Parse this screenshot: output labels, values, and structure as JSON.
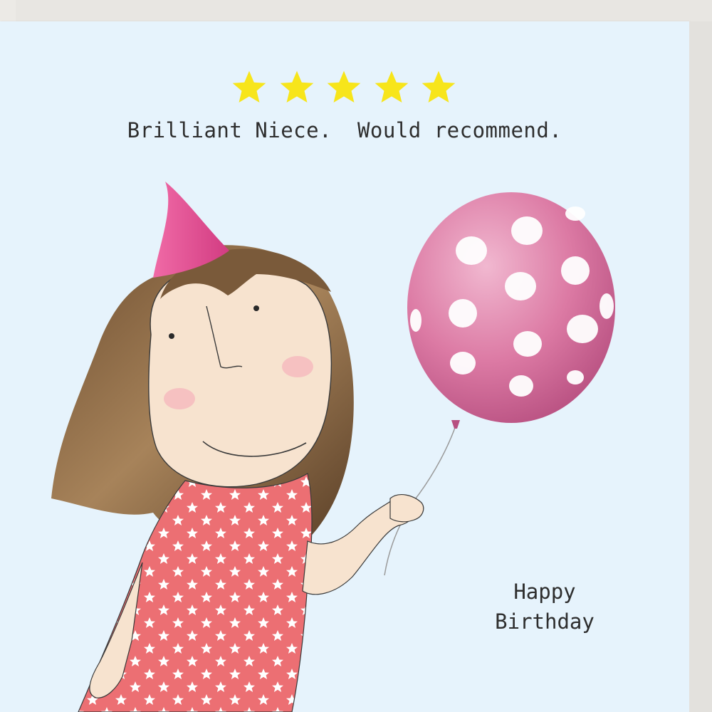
{
  "card": {
    "rating": 5,
    "rating_max": 5,
    "tagline": "Brilliant Niece.  Would recommend.",
    "greeting_line1": "Happy",
    "greeting_line2": "Birthday"
  },
  "colors": {
    "background": "#e6f3fc",
    "star": "#f7e51b",
    "balloon": "#d9749e",
    "dress": "#ec6f73",
    "party_hat": "#e84f92",
    "hair": "#8a6844",
    "skin": "#f7e3cf",
    "text": "#2e2e2e"
  }
}
